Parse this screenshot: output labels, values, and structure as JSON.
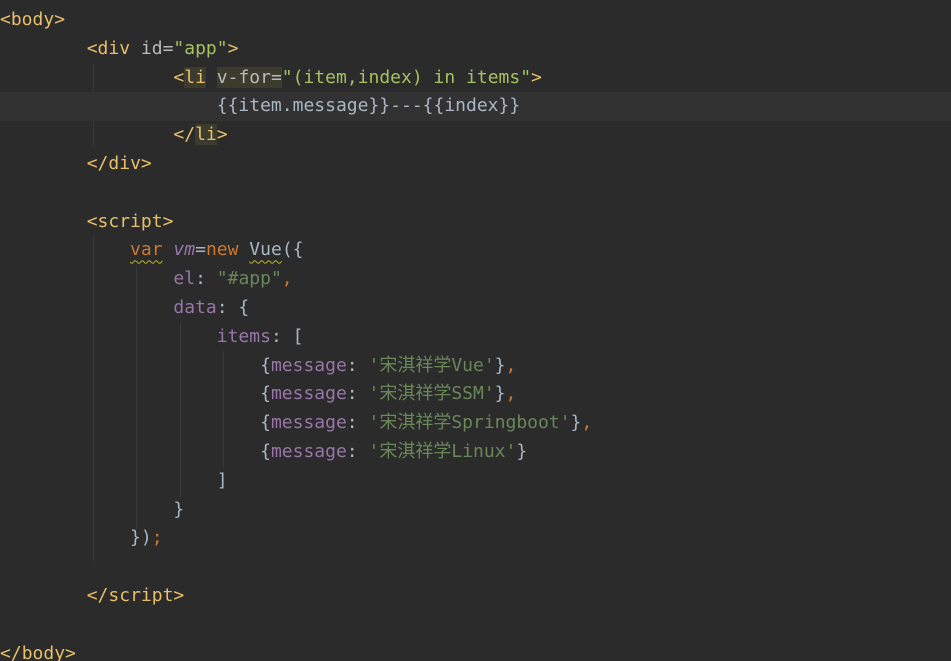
{
  "lines": [
    {
      "tokens": [
        {
          "t": "<",
          "c": "tag-bracket"
        },
        {
          "t": "body",
          "c": "tag-name"
        },
        {
          "t": ">",
          "c": "tag-bracket"
        }
      ]
    },
    {
      "indent": "        ",
      "tokens": [
        {
          "t": "<",
          "c": "tag-bracket"
        },
        {
          "t": "div",
          "c": "tag-name"
        },
        {
          "t": " id=",
          "c": "attr"
        },
        {
          "t": "\"app\"",
          "c": "str"
        },
        {
          "t": ">",
          "c": "tag-bracket"
        }
      ]
    },
    {
      "indent": "                ",
      "tokens": [
        {
          "t": "<",
          "c": "tag-bracket"
        },
        {
          "t": "li",
          "c": "tag-name hl-box"
        },
        {
          "t": " ",
          "c": "plain"
        },
        {
          "t": "v-for=",
          "c": "attr hl-box"
        },
        {
          "t": "\"(item,index) in items\"",
          "c": "str"
        },
        {
          "t": ">",
          "c": "tag-bracket"
        }
      ]
    },
    {
      "indent": "                    ",
      "current": true,
      "tokens": [
        {
          "t": "{{item.message}}---{{index}}",
          "c": "plain"
        }
      ]
    },
    {
      "indent": "                ",
      "tokens": [
        {
          "t": "</",
          "c": "tag-bracket"
        },
        {
          "t": "li",
          "c": "tag-name hl-box"
        },
        {
          "t": ">",
          "c": "tag-bracket"
        }
      ]
    },
    {
      "indent": "        ",
      "tokens": [
        {
          "t": "</",
          "c": "tag-bracket"
        },
        {
          "t": "div",
          "c": "tag-name"
        },
        {
          "t": ">",
          "c": "tag-bracket"
        }
      ]
    },
    {
      "tokens": []
    },
    {
      "indent": "        ",
      "tokens": [
        {
          "t": "<",
          "c": "tag-bracket"
        },
        {
          "t": "script",
          "c": "tag-name"
        },
        {
          "t": ">",
          "c": "tag-bracket"
        }
      ]
    },
    {
      "indent": "            ",
      "tokens": [
        {
          "t": "var",
          "c": "kw squiggle"
        },
        {
          "t": " ",
          "c": "plain"
        },
        {
          "t": "vm",
          "c": "var-it"
        },
        {
          "t": "=",
          "c": "plain"
        },
        {
          "t": "new",
          "c": "kw"
        },
        {
          "t": " ",
          "c": "plain"
        },
        {
          "t": "Vue",
          "c": "plain squiggle"
        },
        {
          "t": "({",
          "c": "plain"
        }
      ]
    },
    {
      "indent": "                ",
      "tokens": [
        {
          "t": "el",
          "c": "prop"
        },
        {
          "t": ": ",
          "c": "plain"
        },
        {
          "t": "\"#app\"",
          "c": "str-js"
        },
        {
          "t": ",",
          "c": "punct"
        }
      ]
    },
    {
      "indent": "                ",
      "tokens": [
        {
          "t": "data",
          "c": "prop"
        },
        {
          "t": ": {",
          "c": "plain"
        }
      ]
    },
    {
      "indent": "                    ",
      "tokens": [
        {
          "t": "items",
          "c": "prop"
        },
        {
          "t": ": [",
          "c": "plain"
        }
      ]
    },
    {
      "indent": "                        ",
      "tokens": [
        {
          "t": "{",
          "c": "plain"
        },
        {
          "t": "message",
          "c": "prop"
        },
        {
          "t": ": ",
          "c": "plain"
        },
        {
          "t": "'宋淇祥学Vue'",
          "c": "str-js"
        },
        {
          "t": "}",
          "c": "plain"
        },
        {
          "t": ",",
          "c": "punct"
        }
      ]
    },
    {
      "indent": "                        ",
      "tokens": [
        {
          "t": "{",
          "c": "plain"
        },
        {
          "t": "message",
          "c": "prop"
        },
        {
          "t": ": ",
          "c": "plain"
        },
        {
          "t": "'宋淇祥学SSM'",
          "c": "str-js"
        },
        {
          "t": "}",
          "c": "plain"
        },
        {
          "t": ",",
          "c": "punct"
        }
      ]
    },
    {
      "indent": "                        ",
      "tokens": [
        {
          "t": "{",
          "c": "plain"
        },
        {
          "t": "message",
          "c": "prop"
        },
        {
          "t": ": ",
          "c": "plain"
        },
        {
          "t": "'宋淇祥学Springboot'",
          "c": "str-js"
        },
        {
          "t": "}",
          "c": "plain"
        },
        {
          "t": ",",
          "c": "punct"
        }
      ]
    },
    {
      "indent": "                        ",
      "tokens": [
        {
          "t": "{",
          "c": "plain"
        },
        {
          "t": "message",
          "c": "prop"
        },
        {
          "t": ": ",
          "c": "plain"
        },
        {
          "t": "'宋淇祥学Linux'",
          "c": "str-js"
        },
        {
          "t": "}",
          "c": "plain"
        }
      ]
    },
    {
      "indent": "                    ",
      "tokens": [
        {
          "t": "]",
          "c": "plain"
        }
      ]
    },
    {
      "indent": "                ",
      "tokens": [
        {
          "t": "}",
          "c": "plain"
        }
      ]
    },
    {
      "indent": "            ",
      "tokens": [
        {
          "t": "})",
          "c": "plain"
        },
        {
          "t": ";",
          "c": "punct"
        }
      ]
    },
    {
      "tokens": []
    },
    {
      "indent": "        ",
      "tokens": [
        {
          "t": "</",
          "c": "tag-bracket"
        },
        {
          "t": "script",
          "c": "tag-name"
        },
        {
          "t": ">",
          "c": "tag-bracket"
        }
      ]
    },
    {
      "tokens": []
    },
    {
      "tokens": [
        {
          "t": "</",
          "c": "tag-bracket"
        },
        {
          "t": "body",
          "c": "tag-name"
        },
        {
          "t": ">",
          "c": "tag-bracket"
        }
      ]
    }
  ]
}
